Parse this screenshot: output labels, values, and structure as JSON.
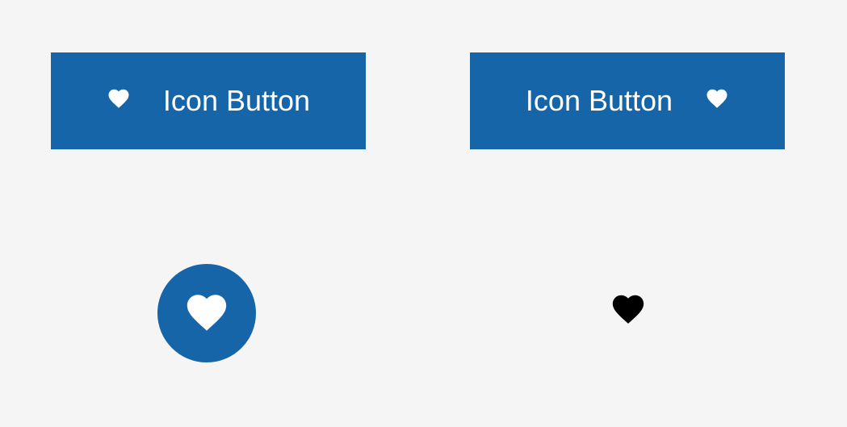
{
  "buttons": {
    "icon_left": {
      "label": "Icon Button"
    },
    "icon_right": {
      "label": "Icon Button"
    }
  },
  "colors": {
    "primary": "#1565a8",
    "icon_dark": "#000000",
    "icon_light": "#ffffff",
    "background": "#f5f5f5"
  }
}
